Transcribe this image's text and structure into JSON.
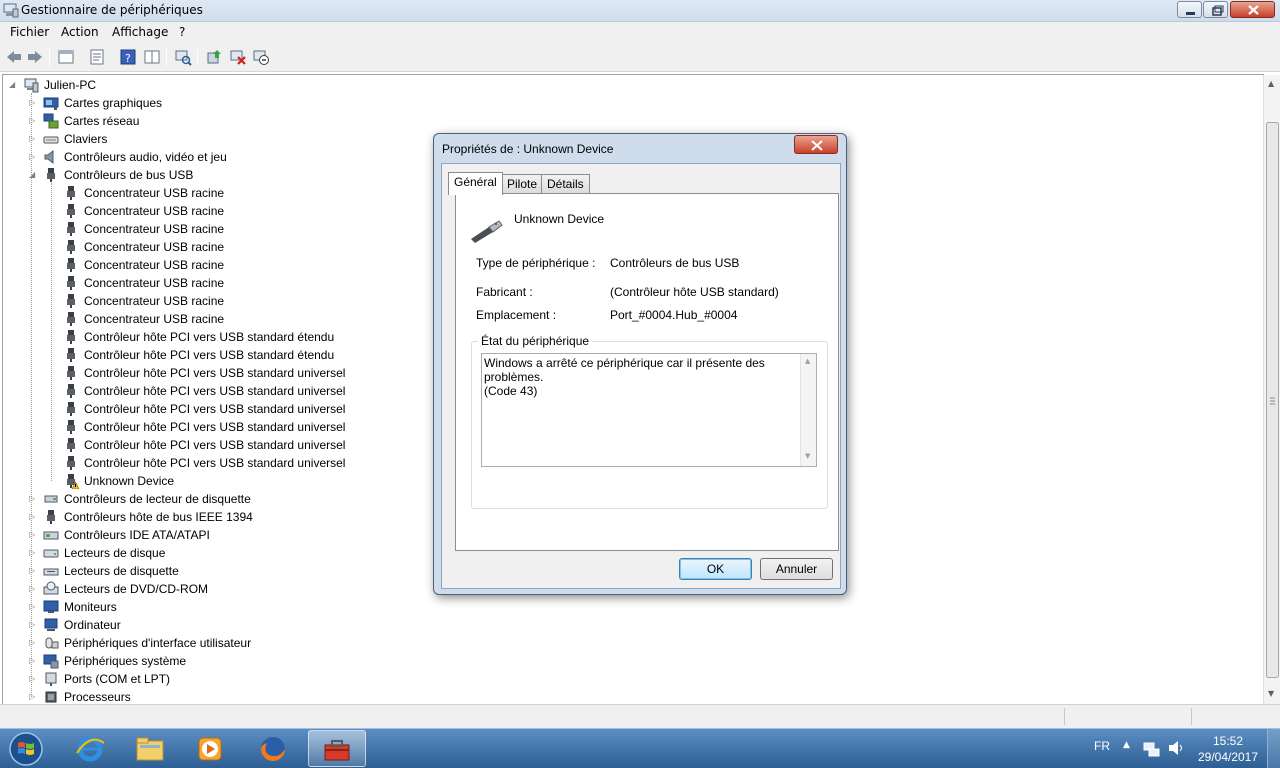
{
  "window": {
    "title": "Gestionnaire de périphériques",
    "menu": [
      "Fichier",
      "Action",
      "Affichage",
      "?"
    ]
  },
  "tree": {
    "root": "Julien-PC",
    "categories_top": [
      "Cartes graphiques",
      "Cartes réseau",
      "Claviers",
      "Contrôleurs audio, vidéo et jeu",
      "Contrôleurs de bus USB"
    ],
    "usb_children": [
      "Concentrateur USB racine",
      "Concentrateur USB racine",
      "Concentrateur USB racine",
      "Concentrateur USB racine",
      "Concentrateur USB racine",
      "Concentrateur USB racine",
      "Concentrateur USB racine",
      "Concentrateur USB racine",
      "Contrôleur hôte PCI vers USB standard étendu",
      "Contrôleur hôte PCI vers USB standard étendu",
      "Contrôleur hôte PCI vers USB standard universel",
      "Contrôleur hôte PCI vers USB standard universel",
      "Contrôleur hôte PCI vers USB standard universel",
      "Contrôleur hôte PCI vers USB standard universel",
      "Contrôleur hôte PCI vers USB standard universel",
      "Contrôleur hôte PCI vers USB standard universel",
      "Unknown Device"
    ],
    "categories_bottom": [
      "Contrôleurs de lecteur de disquette",
      "Contrôleurs hôte de bus IEEE 1394",
      "Contrôleurs IDE ATA/ATAPI",
      "Lecteurs de disque",
      "Lecteurs de disquette",
      "Lecteurs de DVD/CD-ROM",
      "Moniteurs",
      "Ordinateur",
      "Périphériques d'interface utilisateur",
      "Périphériques système",
      "Ports (COM et LPT)",
      "Processeurs"
    ]
  },
  "dialog": {
    "title": "Propriétés de : Unknown Device",
    "tabs": [
      "Général",
      "Pilote",
      "Détails"
    ],
    "device_name": "Unknown Device",
    "fields": [
      {
        "label": "Type de périphérique :",
        "value": "Contrôleurs de bus USB"
      },
      {
        "label": "Fabricant :",
        "value": "(Contrôleur hôte USB standard)"
      },
      {
        "label": "Emplacement :",
        "value": "Port_#0004.Hub_#0004"
      }
    ],
    "state_label": "État du périphérique",
    "state_text": "Windows a arrêté ce périphérique car il présente des problèmes.\n(Code 43)",
    "ok_label": "OK",
    "cancel_label": "Annuler"
  },
  "taskbar": {
    "language": "FR",
    "time": "15:52",
    "date": "29/04/2017"
  },
  "colors": {
    "warning": "#f2c200",
    "taskbar": "#3a6ea5",
    "dialog_frame": "#cfdcec"
  }
}
